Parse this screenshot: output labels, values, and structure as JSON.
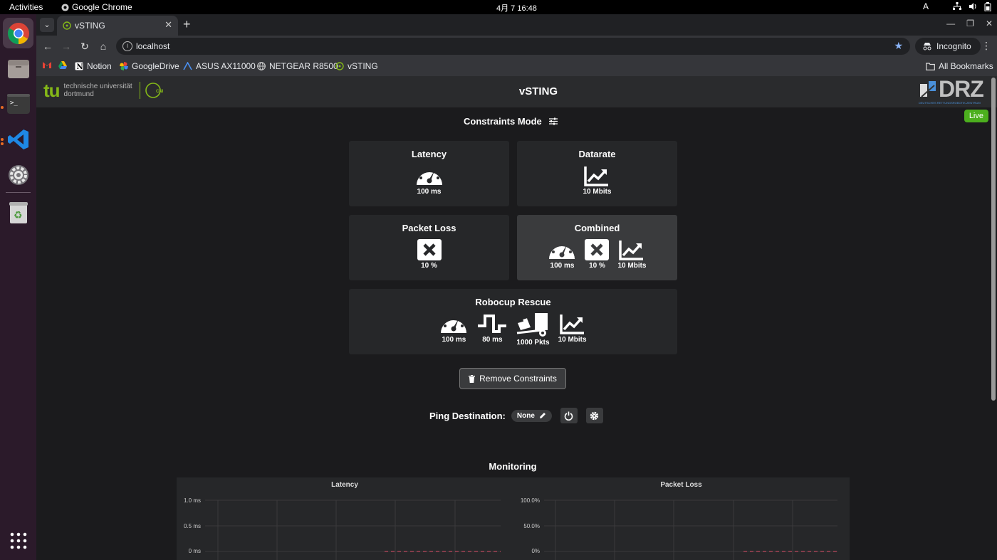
{
  "topbar": {
    "activities": "Activities",
    "app_name": "Google Chrome",
    "clock": "4月 7  16:48",
    "input_indicator": "A"
  },
  "browser": {
    "tab_title": "vSTING",
    "url": "localhost",
    "incognito_label": "Incognito",
    "bookmarks": [
      "Notion",
      "GoogleDrive",
      "ASUS AX11000",
      "NETGEAR R8500",
      "vSTING"
    ],
    "all_bookmarks": "All Bookmarks"
  },
  "app": {
    "title": "vSTING",
    "tu_logo_line1": "technische universität",
    "tu_logo_line2": "dortmund",
    "tu_mark": "tu",
    "cni_mark": "CNI",
    "drz_mark": "DRZ",
    "drz_sub": "DEUTSCHES RETTUNGSROBOTIK-ZENTRUM",
    "live_badge": "Live",
    "mode_title": "Constraints Mode",
    "accent_color": "#84b818",
    "live_color": "#4caf1e"
  },
  "cards": {
    "latency": {
      "title": "Latency",
      "value": "100 ms",
      "icon": "gauge-icon"
    },
    "datarate": {
      "title": "Datarate",
      "value": "10 Mbits",
      "icon": "chart-line-icon"
    },
    "packet_loss": {
      "title": "Packet Loss",
      "value": "10 %",
      "icon": "x-box-icon"
    },
    "combined": {
      "title": "Combined",
      "latency": "100 ms",
      "loss": "10 %",
      "rate": "10 Mbits",
      "selected": true
    },
    "robocup": {
      "title": "Robocup Rescue",
      "latency": "100 ms",
      "jitter": "80 ms",
      "queue": "1000 Pkts",
      "rate": "10 Mbits"
    }
  },
  "remove_button": "Remove Constraints",
  "ping": {
    "label": "Ping Destination:",
    "value": "None"
  },
  "monitoring": {
    "title": "Monitoring",
    "latency_chart": {
      "title": "Latency",
      "yticks": [
        "1.0 ms",
        "0.5 ms",
        "0 ms"
      ]
    },
    "loss_chart": {
      "title": "Packet Loss",
      "yticks": [
        "100.0%",
        "50.0%",
        "0%"
      ]
    }
  }
}
